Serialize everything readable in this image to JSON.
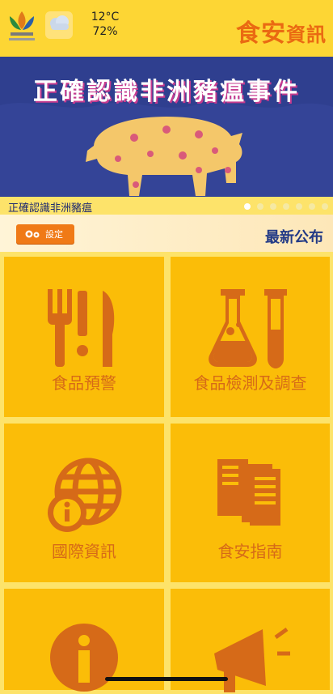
{
  "header": {
    "temperature": "12°C",
    "humidity": "72%",
    "brand_main": "食安",
    "brand_small": "資訊"
  },
  "banner": {
    "title": "正確認識非洲豬瘟事件",
    "caption": "正確認識非洲豬瘟",
    "slides": 7,
    "active_slide": 1
  },
  "toolbar": {
    "settings_label": "設定",
    "latest_label": "最新公布"
  },
  "tiles": [
    {
      "label": "食品預警"
    },
    {
      "label": "食品檢測及調查"
    },
    {
      "label": "國際資訊"
    },
    {
      "label": "食安指南"
    },
    {
      "label": ""
    },
    {
      "label": ""
    }
  ],
  "colors": {
    "accent": "#ea6a12",
    "tile": "#fbbd08",
    "banner": "#2f3f8f"
  }
}
